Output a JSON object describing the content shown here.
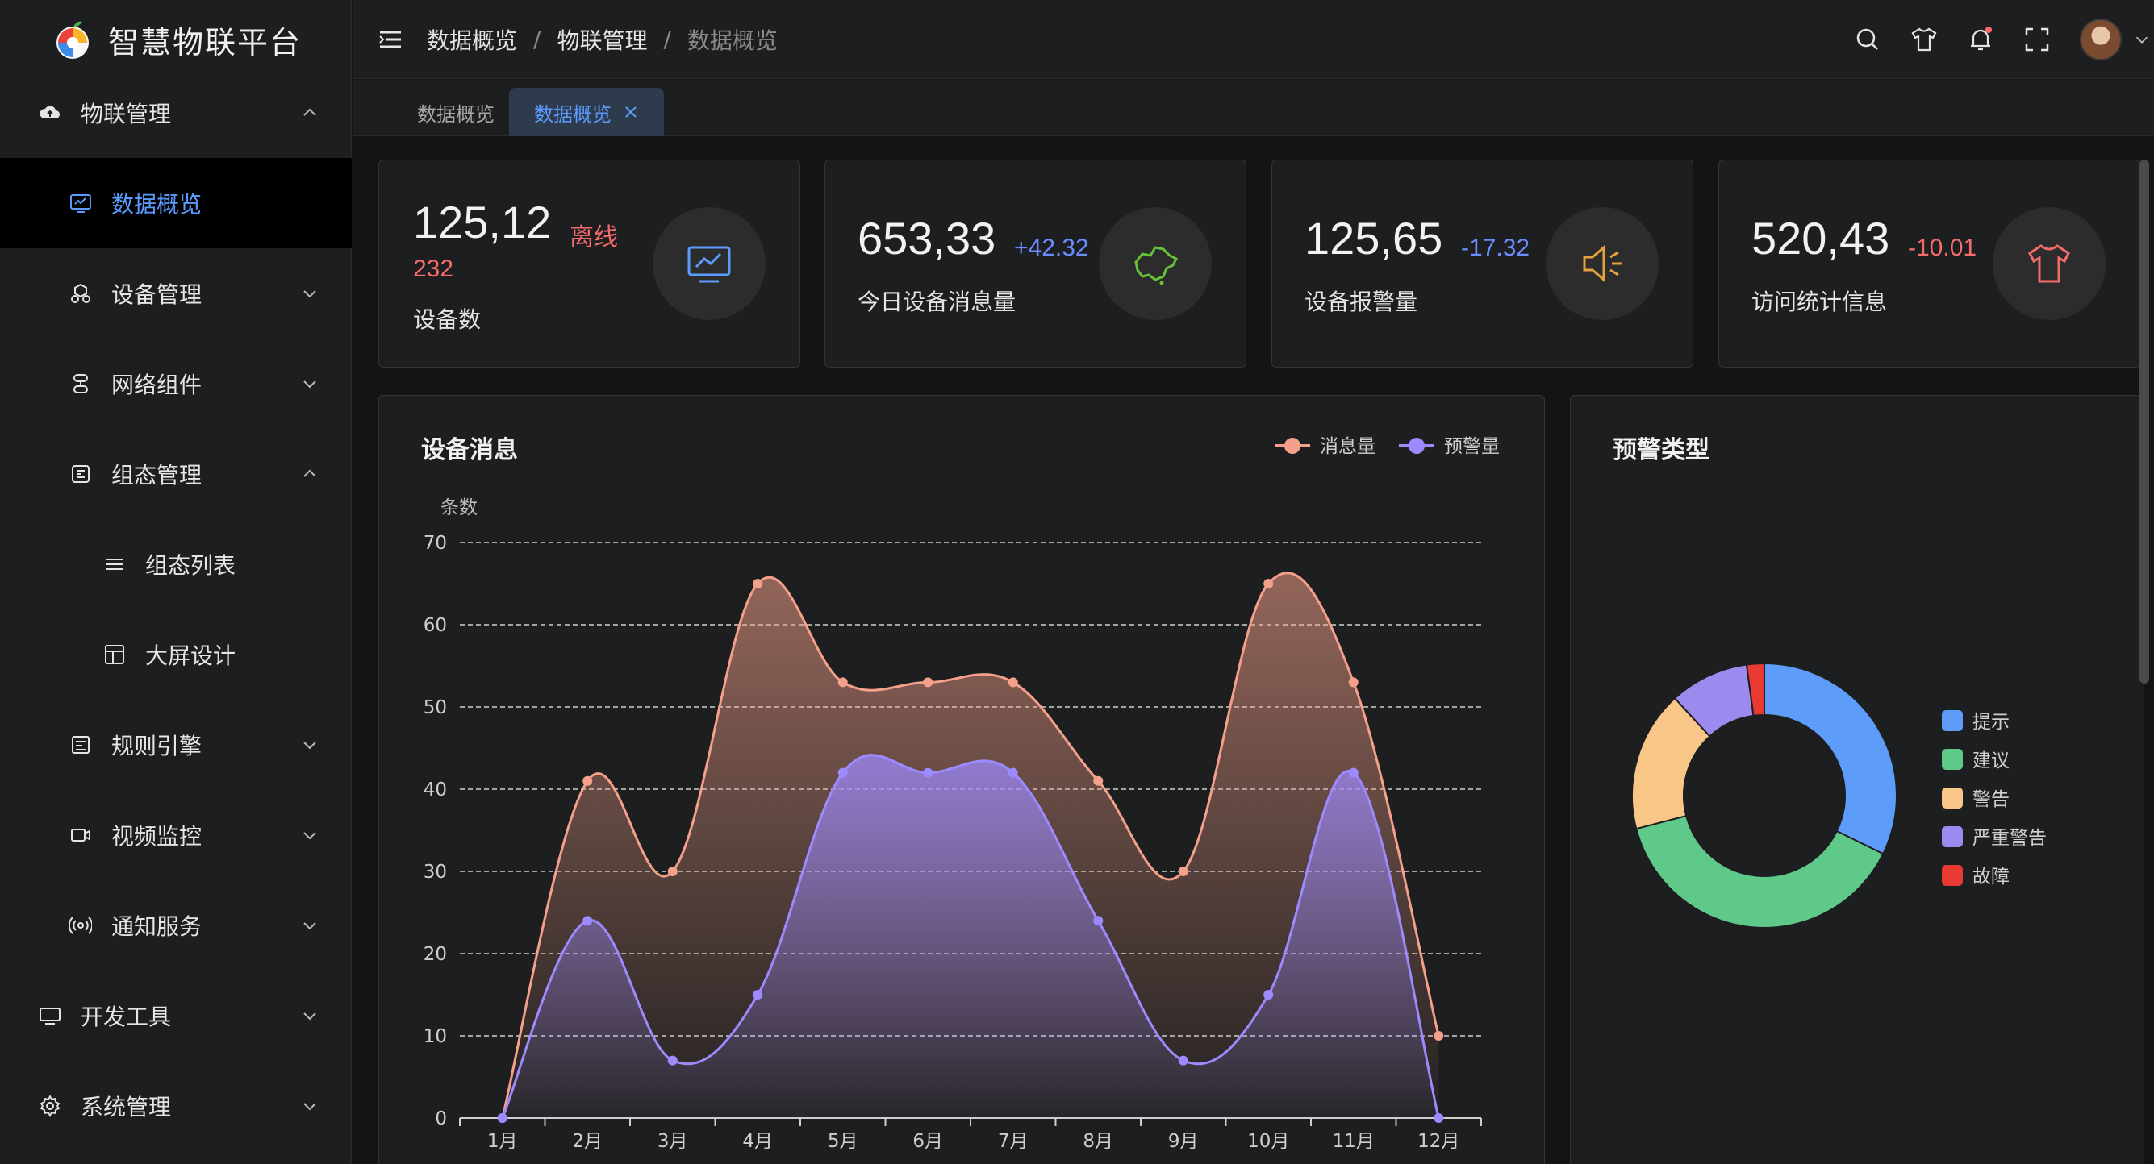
{
  "app": {
    "title": "智慧物联平台"
  },
  "sidebar": {
    "items": [
      {
        "label": "物联管理",
        "icon": "cloud-icon",
        "expanded": true
      },
      {
        "label": "数据概览",
        "icon": "monitor-chart-icon",
        "active": true
      },
      {
        "label": "设备管理",
        "icon": "devices-icon",
        "expanded": false
      },
      {
        "label": "网络组件",
        "icon": "network-icon",
        "expanded": false
      },
      {
        "label": "组态管理",
        "icon": "config-icon",
        "expanded": true
      },
      {
        "label": "组态列表",
        "icon": "list-icon"
      },
      {
        "label": "大屏设计",
        "icon": "screen-design-icon"
      },
      {
        "label": "规则引擎",
        "icon": "rule-engine-icon",
        "expanded": false
      },
      {
        "label": "视频监控",
        "icon": "video-camera-icon",
        "expanded": false
      },
      {
        "label": "通知服务",
        "icon": "broadcast-icon",
        "expanded": false
      },
      {
        "label": "开发工具",
        "icon": "dev-tools-icon",
        "expanded": false
      },
      {
        "label": "系统管理",
        "icon": "gear-icon",
        "expanded": false
      }
    ]
  },
  "header": {
    "breadcrumb": [
      "数据概览",
      "物联管理",
      "数据概览"
    ],
    "tools": [
      "search-icon",
      "shirt-icon",
      "bell-icon",
      "fullscreen-icon",
      "avatar",
      "chevron-down-icon"
    ]
  },
  "tabs": [
    {
      "label": "数据概览",
      "active": false
    },
    {
      "label": "数据概览",
      "active": true
    }
  ],
  "stats": [
    {
      "value": "125,12",
      "delta": "离线",
      "delta2": "232",
      "label": "设备数",
      "delta_color": "#f56c6c",
      "icon": "monitor-chart-icon",
      "icon_color": "#5b9bff"
    },
    {
      "value": "653,33",
      "delta": "+42.32",
      "label": "今日设备消息量",
      "delta_color": "#6b8cff",
      "icon": "china-map-icon",
      "icon_color": "#67c23a"
    },
    {
      "value": "125,65",
      "delta": "-17.32",
      "label": "设备报警量",
      "delta_color": "#6b8cff",
      "icon": "speaker-icon",
      "icon_color": "#e6a23c"
    },
    {
      "value": "520,43",
      "delta": "-10.01",
      "label": "访问统计信息",
      "delta_color": "#f56c6c",
      "icon": "shirt-icon",
      "icon_color": "#f56c6c"
    }
  ],
  "chart_data": [
    {
      "type": "area",
      "title": "设备消息",
      "ylabel": "条数",
      "ylim": [
        0,
        70
      ],
      "yticks": [
        0,
        10,
        20,
        30,
        40,
        50,
        60,
        70
      ],
      "grid": true,
      "legend_position": "top-right",
      "categories": [
        "1月",
        "2月",
        "3月",
        "4月",
        "5月",
        "6月",
        "7月",
        "8月",
        "9月",
        "10月",
        "11月",
        "12月"
      ],
      "series": [
        {
          "name": "消息量",
          "color": "#f4a08a",
          "values": [
            0,
            41,
            30,
            65,
            53,
            53,
            53,
            41,
            30,
            65,
            53,
            10
          ]
        },
        {
          "name": "预警量",
          "color": "#9d8aff",
          "values": [
            0,
            24,
            7,
            15,
            42,
            42,
            42,
            24,
            7,
            15,
            42,
            0
          ]
        }
      ]
    },
    {
      "type": "pie",
      "title": "预警类型",
      "legend_position": "right",
      "slices": [
        {
          "name": "提示",
          "value": 30,
          "color": "#5d9cf8"
        },
        {
          "name": "建议",
          "value": 36,
          "color": "#5fc98a"
        },
        {
          "name": "警告",
          "value": 16,
          "color": "#f8c686"
        },
        {
          "name": "严重警告",
          "value": 9,
          "color": "#9d8aee"
        },
        {
          "name": "故障",
          "value": 2,
          "color": "#e83a33"
        }
      ]
    }
  ]
}
